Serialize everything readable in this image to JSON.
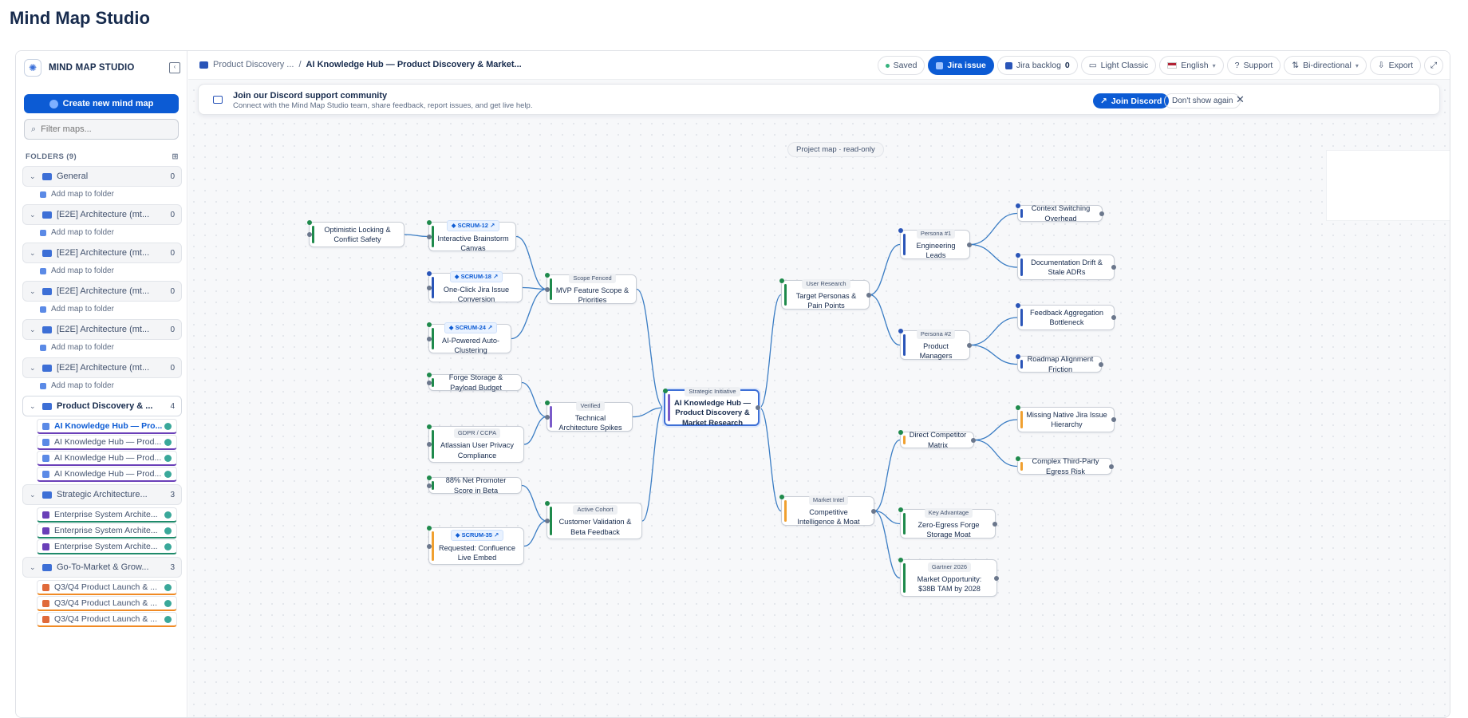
{
  "page_title": "Mind Map Studio",
  "sidebar": {
    "brand": "MIND MAP STUDIO",
    "create_label": "Create new mind map",
    "filter_placeholder": "Filter maps...",
    "folders_label": "FOLDERS (9)",
    "add_map_label": "Add map to folder",
    "folders": [
      {
        "name": "General",
        "count": "0",
        "add": true
      },
      {
        "name": "[E2E] Architecture (mt...",
        "count": "0",
        "add": true
      },
      {
        "name": "[E2E] Architecture (mt...",
        "count": "0",
        "add": true
      },
      {
        "name": "[E2E] Architecture (mt...",
        "count": "0",
        "add": true
      },
      {
        "name": "[E2E] Architecture (mt...",
        "count": "0",
        "add": true
      },
      {
        "name": "[E2E] Architecture (mt...",
        "count": "0",
        "add": true
      },
      {
        "name": "Product Discovery & ...",
        "count": "4",
        "active": true,
        "maps": [
          "AI Knowledge Hub — Pro...",
          "AI Knowledge Hub — Prod...",
          "AI Knowledge Hub — Prod...",
          "AI Knowledge Hub — Prod..."
        ],
        "map_color": "#6a3fb8",
        "map_icon_color": "#5b8ae6"
      },
      {
        "name": "Strategic Architecture...",
        "count": "3",
        "maps": [
          "Enterprise System Archite...",
          "Enterprise System Archite...",
          "Enterprise System Archite..."
        ],
        "map_color": "#1f8a6a",
        "map_icon_color": "#6a3fb8"
      },
      {
        "name": "Go-To-Market & Grow...",
        "count": "3",
        "maps": [
          "Q3/Q4 Product Launch & ...",
          "Q3/Q4 Product Launch & ...",
          "Q3/Q4 Product Launch & ..."
        ],
        "map_color": "#f08a24",
        "map_icon_color": "#e06a3a"
      }
    ]
  },
  "topbar": {
    "breadcrumb_folder": "Product Discovery ...",
    "breadcrumb_sep": "/",
    "breadcrumb_current": "AI Knowledge Hub — Product Discovery & Market...",
    "saved": "Saved",
    "jira_issue": "Jira issue",
    "jira_backlog": "Jira backlog",
    "jira_backlog_count": "0",
    "theme": "Light Classic",
    "language": "English",
    "support": "Support",
    "direction": "Bi-directional",
    "export": "Export"
  },
  "banner": {
    "title": "Join our Discord support community",
    "subtitle": "Connect with the Mind Map Studio team, share feedback, report issues, and get live help.",
    "join": "Join Discord",
    "dont_show": "Don't show again",
    "close": "✕"
  },
  "canvas": {
    "readonly_label": "Project map · read-only"
  },
  "nodes": {
    "root": {
      "tag": "Strategic Initiative",
      "label": "AI Knowledge Hub — Product Discovery & Market Research"
    },
    "mvp": {
      "tag": "Scope Fenced",
      "label": "MVP Feature Scope & Priorities"
    },
    "tech": {
      "tag": "Verified",
      "label": "Technical Architecture Spikes"
    },
    "cust": {
      "tag": "Active Cohort",
      "label": "Customer Validation & Beta Feedback"
    },
    "optim": {
      "label": "Optimistic Locking & Conflict Safety"
    },
    "scrum12": {
      "jira": "SCRUM-12",
      "label": "Interactive Brainstorm Canvas"
    },
    "scrum18": {
      "jira": "SCRUM-18",
      "label": "One-Click Jira Issue Conversion"
    },
    "scrum24": {
      "jira": "SCRUM-24",
      "label": "AI-Powered Auto-Clustering"
    },
    "forge": {
      "label": "Forge Storage & Payload Budget"
    },
    "gdpr": {
      "tag": "GDPR / CCPA",
      "label": "Atlassian User Privacy Compliance"
    },
    "nps": {
      "label": "88% Net Promoter Score in Beta"
    },
    "scrum35": {
      "jira": "SCRUM-35",
      "label": "Requested: Confluence Live Embed"
    },
    "personas": {
      "tag": "User Research",
      "label": "Target Personas & Pain Points"
    },
    "comp": {
      "tag": "Market Intel",
      "label": "Competitive Intelligence & Moat"
    },
    "p1": {
      "tag": "Persona #1",
      "label": "Engineering Leads"
    },
    "p2": {
      "tag": "Persona #2",
      "label": "Product Managers"
    },
    "ctx": {
      "label": "Context Switching Overhead"
    },
    "doc": {
      "label": "Documentation Drift & Stale ADRs"
    },
    "fb": {
      "label": "Feedback Aggregation Bottleneck"
    },
    "road": {
      "label": "Roadmap Alignment Friction"
    },
    "dcm": {
      "label": "Direct Competitor Matrix"
    },
    "adv": {
      "tag": "Key Advantage",
      "label": "Zero-Egress Forge Storage Moat"
    },
    "gart": {
      "tag": "Gartner 2026",
      "label": "Market Opportunity: $38B TAM by 2028"
    },
    "miss": {
      "label": "Missing Native Jira Issue Hierarchy"
    },
    "egress": {
      "label": "Complex Third-Party Egress Risk"
    }
  },
  "colors": {
    "accent": "#0c5bd4",
    "edge": "#3b7dc4",
    "bar_green": "#1f8a4c",
    "bar_purple": "#7a5bc9",
    "bar_blue": "#2a55b8",
    "bar_orange": "#f0a030"
  }
}
